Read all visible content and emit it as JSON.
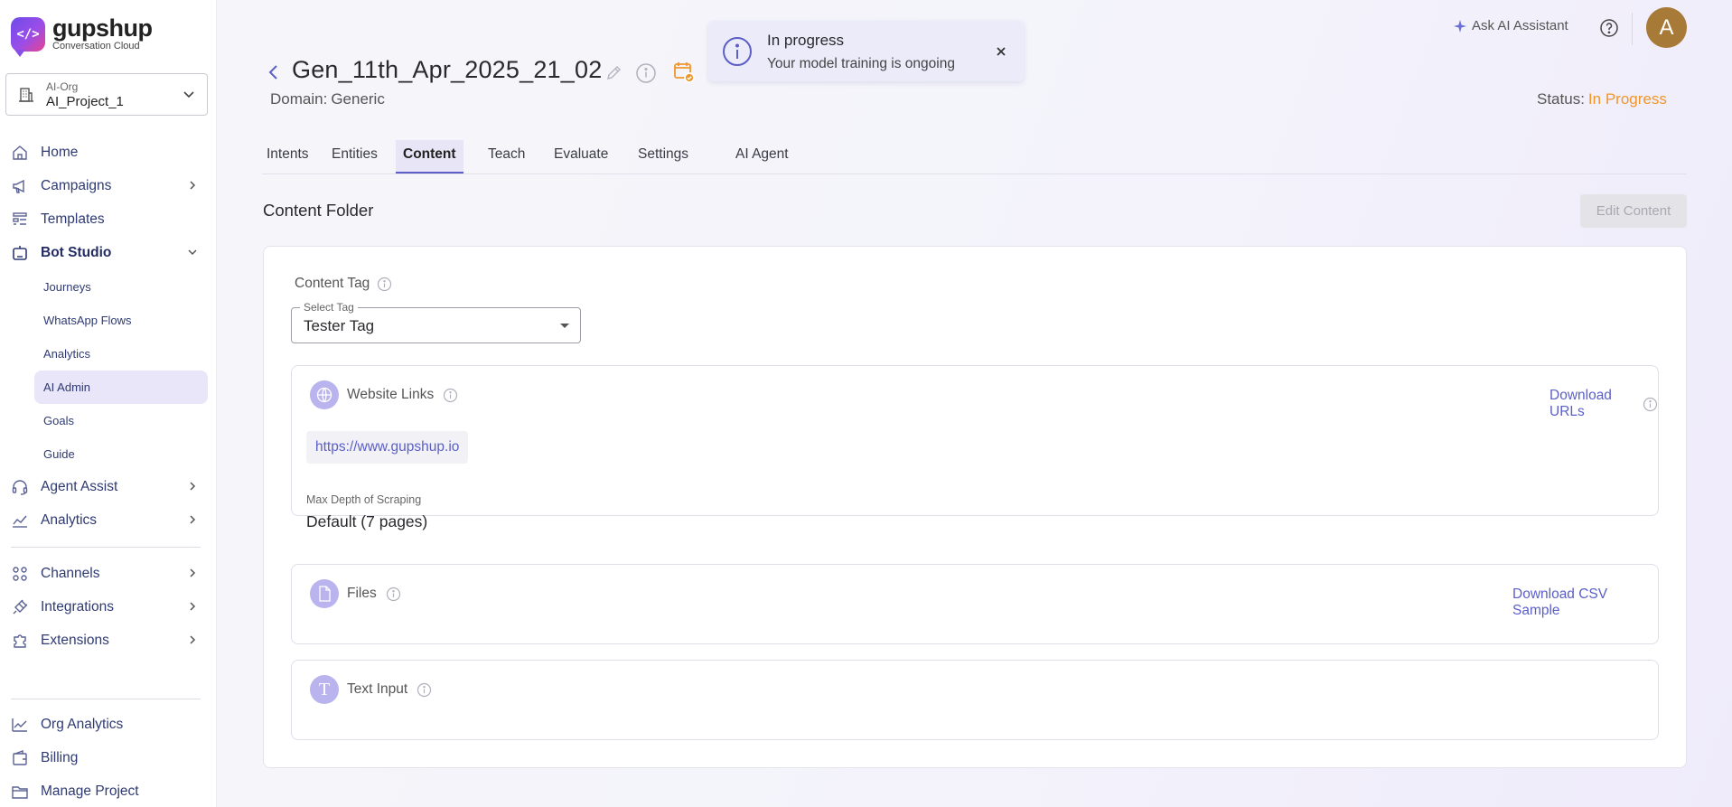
{
  "brand": {
    "logo_glyph": "</>",
    "name": "gupshup",
    "tagline": "Conversation Cloud"
  },
  "org_selector": {
    "label": "AI-Org",
    "value": "AI_Project_1"
  },
  "sidebar": {
    "items": [
      {
        "label": "Home",
        "icon": "home-icon"
      },
      {
        "label": "Campaigns",
        "icon": "megaphone-icon"
      },
      {
        "label": "Templates",
        "icon": "templates-icon"
      },
      {
        "label": "Bot Studio",
        "icon": "bot-icon",
        "expanded": true
      },
      {
        "label": "Agent Assist",
        "icon": "headset-icon"
      },
      {
        "label": "Analytics",
        "icon": "chart-icon"
      },
      {
        "label": "Channels",
        "icon": "channels-icon"
      },
      {
        "label": "Integrations",
        "icon": "plug-icon"
      },
      {
        "label": "Extensions",
        "icon": "puzzle-icon"
      },
      {
        "label": "Org Analytics",
        "icon": "line-chart-icon"
      },
      {
        "label": "Billing",
        "icon": "wallet-icon"
      },
      {
        "label": "Manage Project",
        "icon": "folder-icon"
      }
    ],
    "bot_studio_sub": [
      "Journeys",
      "WhatsApp Flows",
      "Analytics",
      "AI Admin",
      "Goals",
      "Guide"
    ],
    "active_sub": "AI Admin"
  },
  "topbar": {
    "ai_assistant": "Ask AI Assistant",
    "avatar_initial": "A"
  },
  "header": {
    "title": "Gen_11th_Apr_2025_21_02",
    "domain_label": "Domain:",
    "domain_value": "Generic",
    "status_label": "Status:",
    "status_value": "In Progress"
  },
  "tabs": [
    "Intents",
    "Entities",
    "Content",
    "Teach",
    "Evaluate",
    "Settings",
    "AI Agent"
  ],
  "active_tab": "Content",
  "content": {
    "section_title": "Content Folder",
    "edit_button": "Edit Content",
    "tag_label": "Content Tag",
    "select_legend": "Select Tag",
    "select_value": "Tester Tag",
    "website": {
      "title": "Website Links",
      "link": "Download URLs",
      "url": "https://www.gupshup.io",
      "depth_label": "Max Depth of Scraping",
      "depth_value": "Default (7 pages)"
    },
    "files": {
      "title": "Files",
      "link": "Download CSV Sample"
    },
    "text_input": {
      "title": "Text Input",
      "icon_glyph": "T"
    }
  },
  "toast": {
    "title": "In progress",
    "message": "Your model training is ongoing"
  },
  "colors": {
    "accent": "#5b5fc7",
    "status_orange": "#f0962b",
    "active_bg": "#e8e6f8"
  }
}
